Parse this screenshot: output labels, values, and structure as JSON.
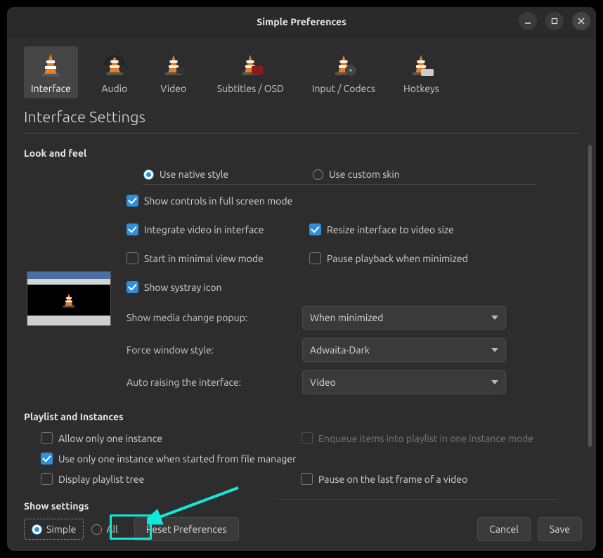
{
  "window": {
    "title": "Simple Preferences"
  },
  "categories": [
    {
      "key": "interface",
      "label": "Interface",
      "active": true
    },
    {
      "key": "audio",
      "label": "Audio"
    },
    {
      "key": "video",
      "label": "Video"
    },
    {
      "key": "subtitles",
      "label": "Subtitles / OSD"
    },
    {
      "key": "input",
      "label": "Input / Codecs"
    },
    {
      "key": "hotkeys",
      "label": "Hotkeys"
    }
  ],
  "heading": "Interface Settings",
  "sections": {
    "look_and_feel": {
      "title": "Look and feel",
      "style_radio": {
        "native": "Use native style",
        "custom": "Use custom skin",
        "selected": "native"
      },
      "checks": {
        "show_controls_fs": {
          "label": "Show controls in full screen mode",
          "checked": true
        },
        "integrate_video": {
          "label": "Integrate video in interface",
          "checked": true
        },
        "resize_interface": {
          "label": "Resize interface to video size",
          "checked": true
        },
        "start_minimal": {
          "label": "Start in minimal view mode",
          "checked": false
        },
        "pause_minimized": {
          "label": "Pause playback when minimized",
          "checked": false
        },
        "show_systray": {
          "label": "Show systray icon",
          "checked": true
        }
      },
      "fields": {
        "media_change": {
          "label": "Show media change popup:",
          "value": "When minimized"
        },
        "window_style": {
          "label": "Force window style:",
          "value": "Adwaita-Dark"
        },
        "auto_raise": {
          "label": "Auto raising the interface:",
          "value": "Video"
        }
      }
    },
    "playlist": {
      "title": "Playlist and Instances",
      "checks": {
        "one_instance": {
          "label": "Allow only one instance",
          "checked": false
        },
        "enqueue": {
          "label": "Enqueue items into playlist in one instance mode",
          "checked": false,
          "disabled": true
        },
        "one_instance_fm": {
          "label": "Use only one instance when started from file manager",
          "checked": true
        },
        "playlist_tree": {
          "label": "Display playlist tree",
          "checked": false
        },
        "pause_last_frame": {
          "label": "Pause on the last frame of a video",
          "checked": false
        }
      }
    }
  },
  "footer": {
    "show_settings_title": "Show settings",
    "mode": {
      "simple": "Simple",
      "all": "All",
      "selected": "simple"
    },
    "reset": "Reset Preferences",
    "cancel": "Cancel",
    "save": "Save"
  },
  "colors": {
    "accent": "#2e8fdc",
    "highlight": "#12e8d8"
  }
}
